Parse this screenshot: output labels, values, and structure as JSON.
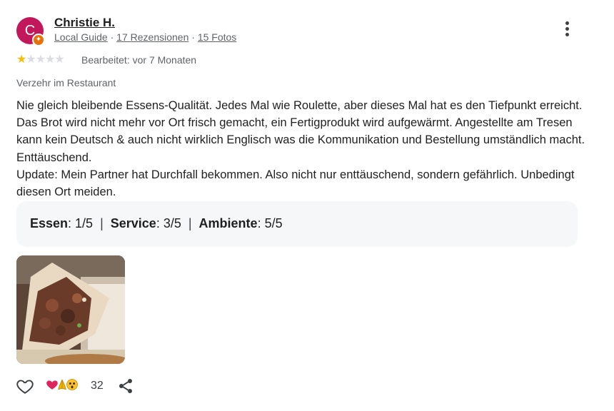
{
  "author": {
    "initial": "C",
    "name": "Christie H.",
    "guide_label": "Local Guide",
    "reviews": "17 Rezensionen",
    "photos": "15 Fotos",
    "separator": " · "
  },
  "rating": {
    "stars_filled": 1,
    "stars_total": 5,
    "edited": "Bearbeitet: vor 7 Monaten"
  },
  "visit_type": "Verzehr im Restaurant",
  "review": {
    "paragraph_1": "Nie gleich bleibende Essens-Qualität. Jedes Mal wie Roulette, aber dieses Mal hat es den Tiefpunkt erreicht. Das Brot wird nicht mehr vor Ort frisch gemacht, ein Fertigprodukt wird aufgewärmt. Angestellte am Tresen kann kein Deutsch & auch nicht wirklich Englisch was die Kommunikation und Bestellung umständlich macht. Enttäuschend.",
    "paragraph_2": "Update: Mein Partner hat Durchfall bekommen. Also nicht nur enttäuschend, sondern gefährlich. Unbedingt diesen Ort meiden."
  },
  "sub_ratings": {
    "food_label": "Essen",
    "food_value": ": 1/5",
    "service_label": "Service",
    "service_value": ": 3/5",
    "ambience_label": "Ambiente",
    "ambience_value": ": 5/5",
    "separator": "|"
  },
  "reactions": {
    "count": "32",
    "icons": [
      "heart",
      "folded-hands",
      "astonished-face"
    ]
  },
  "colors": {
    "avatar": "#c2185b",
    "star": "#fbbc04",
    "badge": "#e8710a"
  }
}
